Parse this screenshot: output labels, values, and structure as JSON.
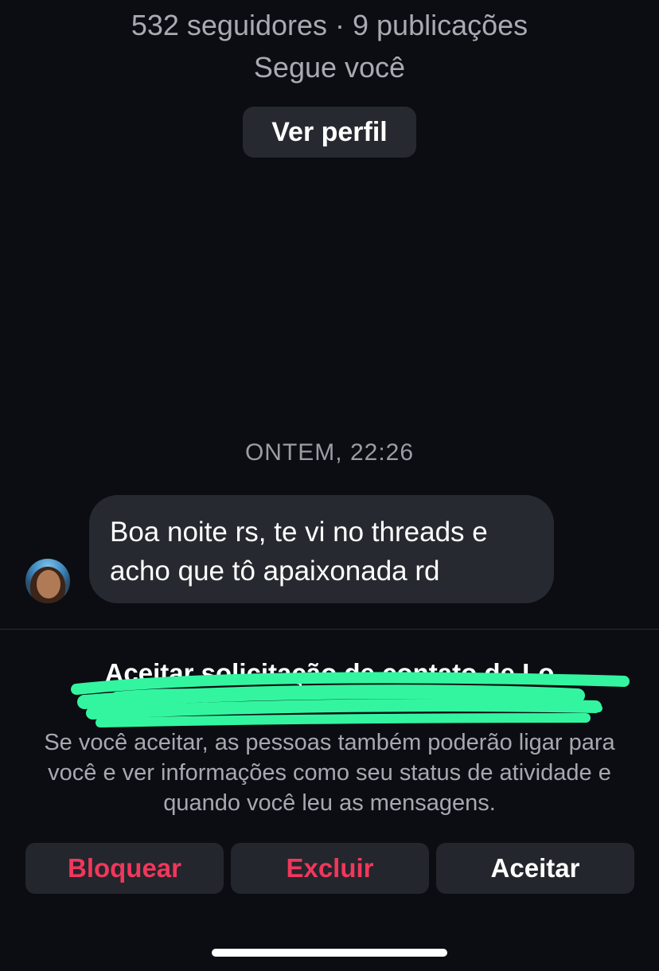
{
  "profile": {
    "stats": "532 seguidores · 9 publicações",
    "follows_you": "Segue você",
    "view_profile_label": "Ver perfil"
  },
  "conversation": {
    "timestamp": "ONTEM, 22:26",
    "messages": [
      {
        "sender": "other",
        "line1": "Boa noite rs, te vi no threads e",
        "line2": "acho que tô apaixonada rd"
      }
    ]
  },
  "request": {
    "title": "Aceitar solicitação de contato de Lo",
    "description": "Se você aceitar, as pessoas também poderão ligar para você e ver informações como seu status de atividade e quando você leu as mensagens.",
    "redaction_color": "#33f5a0"
  },
  "actions": {
    "block_label": "Bloquear",
    "delete_label": "Excluir",
    "accept_label": "Aceitar",
    "destructive_color": "#f0375c"
  }
}
